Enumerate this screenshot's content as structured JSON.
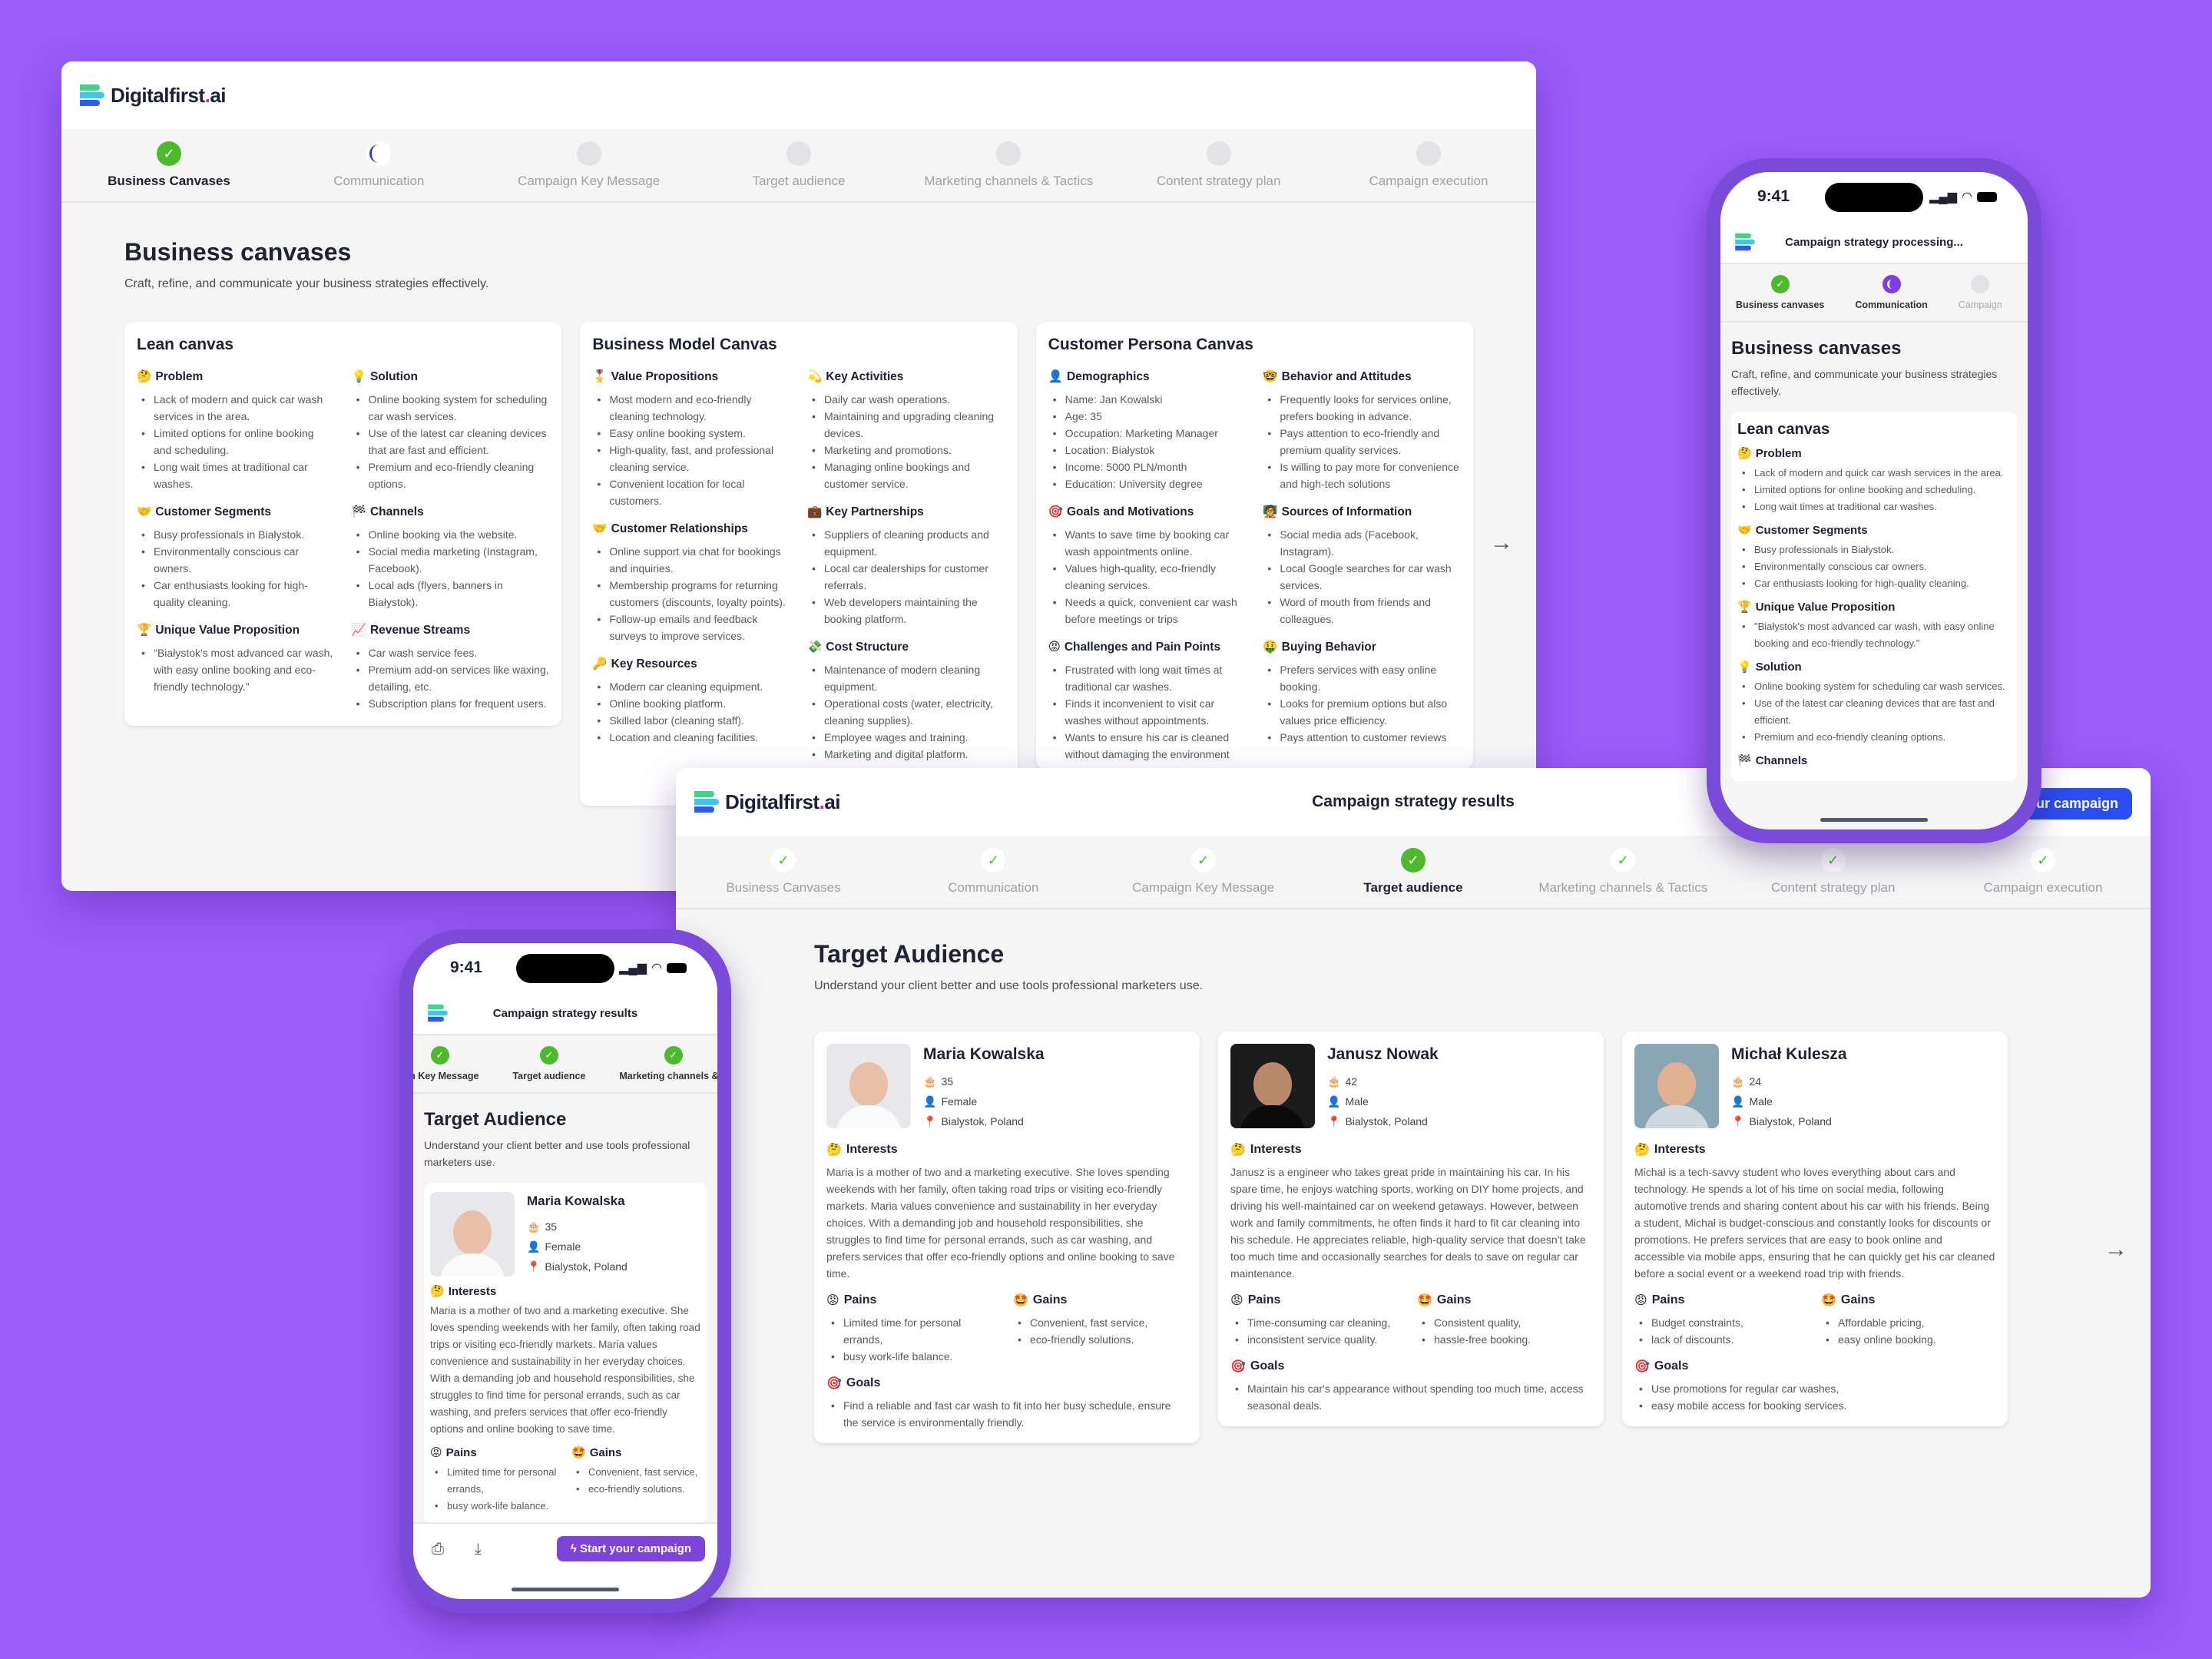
{
  "brand": {
    "name": "Digitalfirst",
    "suffix": "ai",
    "dot": "."
  },
  "colors": {
    "background": "#9a5cfb",
    "success": "#4cba2c",
    "primary_blue": "#2b4ef0",
    "primary_purple": "#7e44d8"
  },
  "icons": {
    "check": "✓",
    "arrow_right": "→",
    "thinking": "🤔",
    "bulb": "💡",
    "handshake": "🤝",
    "flag": "🏁",
    "trophy": "🏆",
    "chart": "📈",
    "medal": "🎖️",
    "dizzy": "💫",
    "briefcase": "💼",
    "money": "💸",
    "key": "🔑",
    "user": "👤",
    "nerd": "🤓",
    "target": "🎯",
    "teacher": "🧑‍🏫",
    "angry": "😡",
    "money_face": "🤑",
    "cake": "🎂",
    "pin": "📍",
    "star_eyes": "🤩",
    "print": "⎙",
    "download": "⤓",
    "bolt": "ϟ"
  },
  "desktop1": {
    "steps": [
      {
        "label": "Business Canvases",
        "state": "done"
      },
      {
        "label": "Communication",
        "state": "loading"
      },
      {
        "label": "Campaign Key Message",
        "state": "pending"
      },
      {
        "label": "Target audience",
        "state": "pending"
      },
      {
        "label": "Marketing channels & Tactics",
        "state": "pending"
      },
      {
        "label": "Content strategy plan",
        "state": "pending"
      },
      {
        "label": "Campaign execution",
        "state": "pending"
      }
    ],
    "title": "Business canvases",
    "subtitle": "Craft, refine, and communicate your business strategies effectively.",
    "lean": {
      "title": "Lean canvas",
      "problem": {
        "title": "Problem",
        "items": [
          "Lack of modern and quick car wash services in the area.",
          "Limited options for online booking and scheduling.",
          "Long wait times at traditional car washes."
        ]
      },
      "solution": {
        "title": "Solution",
        "items": [
          "Online booking system for scheduling car wash services.",
          "Use of the latest car cleaning devices that are fast and efficient.",
          "Premium and eco-friendly cleaning options."
        ]
      },
      "segments": {
        "title": "Customer Segments",
        "items": [
          "Busy professionals in Białystok.",
          "Environmentally conscious car owners.",
          "Car enthusiasts looking for high-quality cleaning."
        ]
      },
      "channels": {
        "title": "Channels",
        "items": [
          "Online booking via the website.",
          "Social media marketing (Instagram, Facebook).",
          "Local ads (flyers, banners in Białystok)."
        ]
      },
      "uvp": {
        "title": "Unique Value Proposition",
        "items": [
          "\"Białystok's most advanced car wash, with easy online booking and eco-friendly technology.\""
        ]
      },
      "revenue": {
        "title": "Revenue Streams",
        "items": [
          "Car wash service fees.",
          "Premium add-on services like waxing, detailing, etc.",
          "Subscription plans for frequent users."
        ]
      }
    },
    "bmc": {
      "title": "Business Model Canvas",
      "value": {
        "title": "Value Propositions",
        "items": [
          "Most modern and eco-friendly cleaning technology.",
          "Easy online booking system.",
          "High-quality, fast, and professional cleaning service.",
          "Convenient location for local customers."
        ]
      },
      "activities": {
        "title": "Key Activities",
        "items": [
          "Daily car wash operations.",
          "Maintaining and upgrading cleaning devices.",
          "Marketing and promotions.",
          "Managing online bookings and customer service."
        ]
      },
      "relationships": {
        "title": "Customer Relationships",
        "items": [
          "Online support via chat for bookings and inquiries.",
          "Membership programs for returning customers (discounts, loyalty points).",
          "Follow-up emails and feedback surveys to improve services."
        ]
      },
      "partnerships": {
        "title": "Key Partnerships",
        "items": [
          "Suppliers of cleaning products and equipment.",
          "Local car dealerships for customer referrals.",
          "Web developers maintaining the booking platform."
        ]
      },
      "resources": {
        "title": "Key Resources",
        "items": [
          "Modern car cleaning equipment.",
          "Online booking platform.",
          "Skilled labor (cleaning staff).",
          "Location and cleaning facilities."
        ]
      },
      "costs": {
        "title": "Cost Structure",
        "items": [
          "Maintenance of modern cleaning equipment.",
          "Operational costs (water, electricity, cleaning supplies).",
          "Employee wages and training.",
          "Marketing and digital platform."
        ]
      }
    },
    "persona": {
      "title": "Customer Persona Canvas",
      "demographics": {
        "title": "Demographics",
        "items": [
          "Name: Jan Kowalski",
          "Age: 35",
          "Occupation: Marketing Manager",
          "Location: Białystok",
          "Income: 5000 PLN/month",
          "Education: University degree"
        ]
      },
      "behavior": {
        "title": "Behavior and Attitudes",
        "items": [
          "Frequently looks for services online, prefers booking in advance.",
          "Pays attention to eco-friendly and premium quality services.",
          "Is willing to pay more for convenience and high-tech solutions"
        ]
      },
      "goals": {
        "title": "Goals and Motivations",
        "items": [
          "Wants to save time by booking car wash appointments online.",
          "Values high-quality, eco-friendly cleaning services.",
          "Needs a quick, convenient car wash before meetings or trips"
        ]
      },
      "sources": {
        "title": "Sources of Information",
        "items": [
          "Social media ads (Facebook, Instagram).",
          "Local Google searches for car wash services.",
          "Word of mouth from friends and colleagues."
        ]
      },
      "challenges": {
        "title": "Challenges and Pain Points",
        "items": [
          "Frustrated with long wait times at traditional car washes.",
          "Finds it inconvenient to visit car washes without appointments.",
          "Wants to ensure his car is cleaned without damaging the environment"
        ]
      },
      "buying": {
        "title": "Buying Behavior",
        "items": [
          "Prefers services with easy online booking.",
          "Looks for premium options but also values price efficiency.",
          "Pays attention to customer reviews"
        ]
      }
    }
  },
  "desktop2": {
    "header_title": "Campaign strategy results",
    "cta": "Start your campaign",
    "steps": [
      {
        "label": "Business Canvases",
        "state": "done"
      },
      {
        "label": "Communication",
        "state": "done"
      },
      {
        "label": "Campaign Key Message",
        "state": "done"
      },
      {
        "label": "Target audience",
        "state": "active"
      },
      {
        "label": "Marketing channels & Tactics",
        "state": "done"
      },
      {
        "label": "Content strategy plan",
        "state": "done"
      },
      {
        "label": "Campaign execution",
        "state": "done"
      }
    ],
    "title": "Target Audience",
    "subtitle": "Understand your client better and use tools professional marketers use.",
    "labels": {
      "interests": "Interests",
      "pains": "Pains",
      "gains": "Gains",
      "goals": "Goals"
    },
    "personas": [
      {
        "name": "Maria Kowalska",
        "age": "35",
        "gender": "Female",
        "location": "Bialystok, Poland",
        "interests": "Maria is a mother of two and a marketing executive. She loves spending weekends with her family, often taking road trips or visiting eco-friendly markets. Maria values convenience and sustainability in her everyday choices. With a demanding job and household responsibilities, she struggles to find time for personal errands, such as car washing, and prefers services that offer eco-friendly options and online booking to save time.",
        "pains": [
          "Limited time for personal errands,",
          "busy work-life balance."
        ],
        "gains": [
          "Convenient, fast service,",
          "eco-friendly solutions."
        ],
        "goals": [
          "Find a reliable and fast car wash to fit into her busy schedule, ensure the service is environmentally friendly."
        ]
      },
      {
        "name": "Janusz Nowak",
        "age": "42",
        "gender": "Male",
        "location": "Bialystok, Poland",
        "interests": "Janusz is a engineer who takes great pride in maintaining his car. In his spare time, he enjoys watching sports, working on DIY home projects, and driving his well-maintained car on weekend getaways. However, between work and family commitments, he often finds it hard to fit car cleaning into his schedule. He appreciates reliable, high-quality service that doesn't take too much time and occasionally searches for deals to save on regular car maintenance.",
        "pains": [
          "Time-consuming car cleaning,",
          "inconsistent service quality."
        ],
        "gains": [
          "Consistent quality,",
          "hassle-free booking."
        ],
        "goals": [
          "Maintain his car's appearance without spending too much time, access seasonal deals."
        ]
      },
      {
        "name": "Michał Kulesza",
        "age": "24",
        "gender": "Male",
        "location": "Bialystok, Poland",
        "interests": "Michał is a tech-savvy student who loves everything about cars and technology. He spends a lot of his time on social media, following automotive trends and sharing content about his car with his friends. Being a student, Michał is budget-conscious and constantly looks for discounts or promotions. He prefers services that are easy to book online and accessible via mobile apps, ensuring that he can quickly get his car cleaned before a social event or a weekend road trip with friends.",
        "pains": [
          "Budget constraints,",
          "lack of discounts."
        ],
        "gains": [
          "Affordable pricing,",
          "easy online booking."
        ],
        "goals": [
          "Use promotions for regular car washes,",
          "easy mobile access for booking services."
        ]
      }
    ]
  },
  "phone1": {
    "time": "9:41",
    "header_title": "Campaign strategy processing...",
    "steps": [
      {
        "label": "Business canvases",
        "state": "done"
      },
      {
        "label": "Communication",
        "state": "loading"
      },
      {
        "label": "Campaign",
        "state": "pending"
      }
    ],
    "title": "Business canvases",
    "subtitle": "Craft, refine, and communicate your business strategies effectively.",
    "card_title": "Lean canvas",
    "problem": {
      "title": "Problem",
      "items": [
        "Lack of modern and quick car wash services in the area.",
        "Limited options for online booking and scheduling.",
        "Long wait times at traditional car washes."
      ]
    },
    "segments": {
      "title": "Customer Segments",
      "items": [
        "Busy professionals in Białystok.",
        "Environmentally conscious car owners.",
        "Car enthusiasts looking for high-quality cleaning."
      ]
    },
    "uvp": {
      "title": "Unique Value Proposition",
      "items": [
        "\"Białystok's most advanced car wash, with easy online booking and eco-friendly technology.\""
      ]
    },
    "solution": {
      "title": "Solution",
      "items": [
        "Online booking system for scheduling car wash services.",
        "Use of the latest car cleaning devices that are fast and efficient.",
        "Premium and eco-friendly cleaning options."
      ]
    },
    "channels": {
      "title": "Channels"
    }
  },
  "phone2": {
    "time": "9:41",
    "header_title": "Campaign strategy results",
    "steps": [
      {
        "label": "ign Key Message",
        "state": "done"
      },
      {
        "label": "Target audience",
        "state": "done"
      },
      {
        "label": "Marketing channels & T",
        "state": "done"
      }
    ],
    "title": "Target Audience",
    "subtitle": "Understand your client better and use tools professional marketers use.",
    "cta": "Start your campaign",
    "persona": {
      "name": "Maria Kowalska",
      "age": "35",
      "gender": "Female",
      "location": "Bialystok, Poland",
      "interests": "Maria is a mother of two and a marketing executive. She loves spending weekends with her family, often taking road trips or visiting eco-friendly markets. Maria values convenience and sustainability in her everyday choices. With a demanding job and household responsibilities, she struggles to find time for personal errands, such as car washing, and prefers services that offer eco-friendly options and online booking to save time.",
      "pains": [
        "Limited time for personal errands,",
        "busy work-life balance."
      ],
      "gains": [
        "Convenient, fast service,",
        "eco-friendly solutions."
      ]
    }
  }
}
